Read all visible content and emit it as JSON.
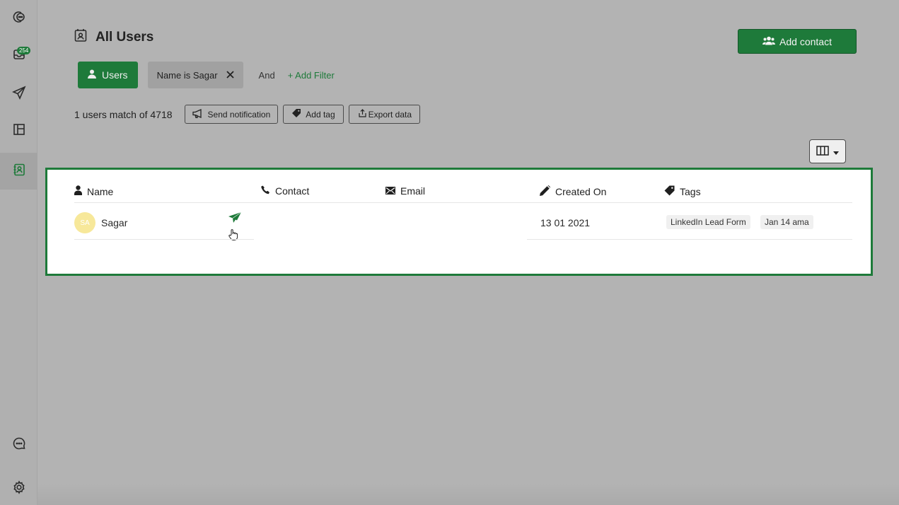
{
  "sidebar": {
    "items": [
      {
        "icon": "chat-bubble-logo-icon"
      },
      {
        "icon": "inbox-icon",
        "badge": "254"
      },
      {
        "icon": "send-icon"
      },
      {
        "icon": "layout-icon"
      },
      {
        "icon": "contacts-book-icon",
        "active": true
      }
    ],
    "bottom_items": [
      {
        "icon": "message-icon"
      },
      {
        "icon": "settings-gear-icon"
      }
    ]
  },
  "header": {
    "title": "All Users",
    "add_contact_label": "Add contact"
  },
  "filters": {
    "segment_label": "Users",
    "active_filter": "Name is Sagar",
    "conjunction": "And",
    "add_filter_label": "+ Add Filter"
  },
  "toolbar": {
    "match_text": "1 users match of 4718",
    "send_notification": "Send notification",
    "add_tag": "Add tag",
    "export_data": "Export data"
  },
  "table": {
    "columns": [
      "Name",
      "Contact",
      "Email",
      "Created On",
      "Tags"
    ],
    "rows": [
      {
        "avatar_initials": "SA",
        "name": "Sagar",
        "contact": "",
        "email": "",
        "created_on": "13 01 2021",
        "tags": [
          "LinkedIn Lead Form",
          "Jan 14 ama"
        ]
      }
    ]
  },
  "colors": {
    "accent": "#1e7a3a",
    "background": "#b3b3b3",
    "avatar": "#f7e89a"
  }
}
